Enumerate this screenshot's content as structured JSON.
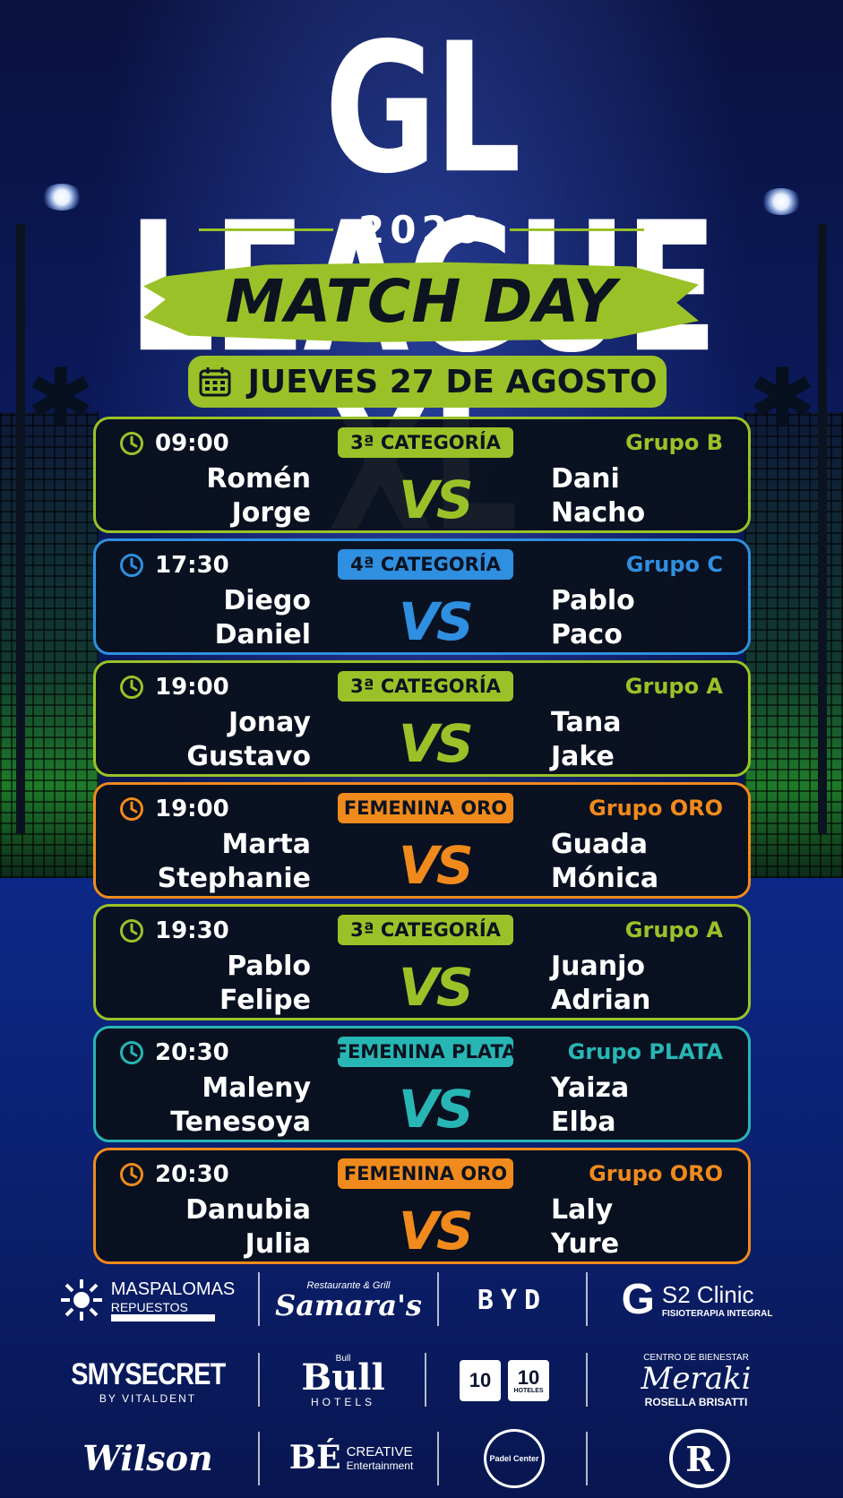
{
  "header": {
    "title": "GL LEAGUE XL",
    "year": "2026",
    "subtitle": "MATCH DAY",
    "date": "JUEVES 27 DE AGOSTO"
  },
  "colors": {
    "green": "#9ac228",
    "blue": "#2f8fe0",
    "orange": "#f08a1c",
    "teal": "#27b6b4",
    "card_bg": "#0a101c"
  },
  "matches": [
    {
      "time": "09:00",
      "category": "3ª CATEGORÍA",
      "group": "Grupo B",
      "team1": [
        "Romén",
        "Jorge"
      ],
      "team2": [
        "Dani",
        "Nacho"
      ],
      "color": "#9ac228"
    },
    {
      "time": "17:30",
      "category": "4ª CATEGORÍA",
      "group": "Grupo C",
      "team1": [
        "Diego",
        "Daniel"
      ],
      "team2": [
        "Pablo",
        "Paco"
      ],
      "color": "#2f8fe0"
    },
    {
      "time": "19:00",
      "category": "3ª CATEGORÍA",
      "group": "Grupo A",
      "team1": [
        "Jonay",
        "Gustavo"
      ],
      "team2": [
        "Tana",
        "Jake"
      ],
      "color": "#9ac228"
    },
    {
      "time": "19:00",
      "category": "FEMENINA ORO",
      "group": "Grupo ORO",
      "team1": [
        "Marta",
        "Stephanie"
      ],
      "team2": [
        "Guada",
        "Mónica"
      ],
      "color": "#f08a1c"
    },
    {
      "time": "19:30",
      "category": "3ª CATEGORÍA",
      "group": "Grupo A",
      "team1": [
        "Pablo",
        "Felipe"
      ],
      "team2": [
        "Juanjo",
        "Adrian"
      ],
      "color": "#9ac228"
    },
    {
      "time": "20:30",
      "category": "FEMENINA PLATA",
      "group": "Grupo PLATA",
      "team1": [
        "Maleny",
        "Tenesoya"
      ],
      "team2": [
        "Yaiza",
        "Elba"
      ],
      "color": "#27b6b4"
    },
    {
      "time": "20:30",
      "category": "FEMENINA ORO",
      "group": "Grupo ORO",
      "team1": [
        "Danubia",
        "Julia"
      ],
      "team2": [
        "Laly",
        "Yure"
      ],
      "color": "#f08a1c"
    }
  ],
  "vs_label": "VS",
  "sponsors": {
    "maspalomas": {
      "name": "MASPALOMAS",
      "sub": "REPUESTOS"
    },
    "samaras": {
      "top": "Restaurante & Grill",
      "name": "Samara's"
    },
    "byd": {
      "name": "BYD"
    },
    "s2": {
      "g": "G",
      "name": "S2 Clinic",
      "sub": "FISIOTERAPIA INTEGRAL"
    },
    "smysecret": {
      "name": "SMYSECRET",
      "sub": "BY VITALDENT"
    },
    "bull": {
      "top": "Bull",
      "name": "Bull",
      "sub": "HOTELS"
    },
    "tenten": {
      "a": "10",
      "b": "10",
      "sub": "HOTELES"
    },
    "meraki": {
      "top": "CENTRO DE BIENESTAR",
      "name": "Meraki",
      "sub": "ROSELLA BRISATTI"
    },
    "wilson": {
      "name": "Wilson"
    },
    "be": {
      "name": "BÉ",
      "a": "CREATIVE",
      "b": "Entertainment"
    },
    "padel": {
      "name": "Padel Center"
    },
    "r": {
      "name": "R"
    }
  }
}
